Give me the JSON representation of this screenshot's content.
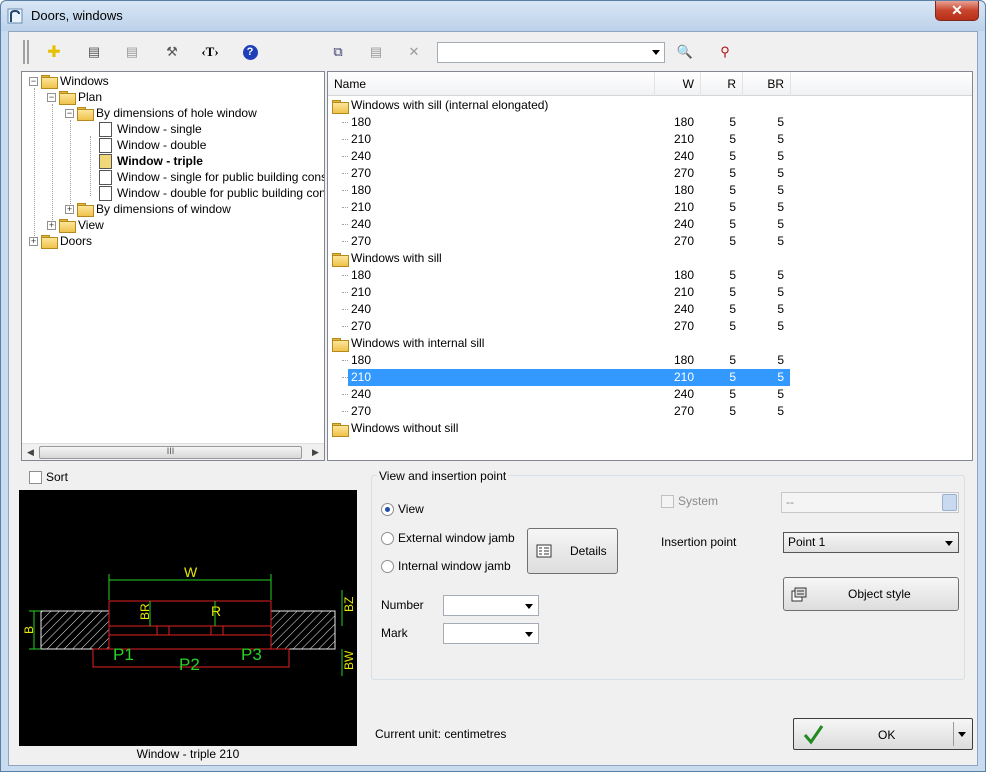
{
  "window": {
    "title": "Doors, windows",
    "close_label": "✕"
  },
  "toolbar": {
    "buttons": [
      {
        "name": "add-icon",
        "glyph": "✚",
        "color": "#e6c000"
      },
      {
        "name": "edit-icon",
        "glyph": "▤",
        "color": "#555555"
      },
      {
        "name": "list-icon",
        "glyph": "▤",
        "color": "#9a9a9a"
      },
      {
        "name": "tools-icon",
        "glyph": "⚒",
        "color": "#555555"
      },
      {
        "name": "text-icon",
        "glyph": "‹T›",
        "color": "#000000"
      },
      {
        "name": "help-icon",
        "glyph": "?",
        "color": "#ffffff"
      },
      {
        "name": "copy-icon",
        "glyph": "⧉",
        "color": "#3a3a6a"
      },
      {
        "name": "properties-icon",
        "glyph": "▤",
        "color": "#9a9a9a"
      },
      {
        "name": "delete-icon",
        "glyph": "✕",
        "color": "#9a9a9a"
      },
      {
        "name": "search-icon",
        "glyph": "🔍",
        "color": "#1f4fa8"
      },
      {
        "name": "binoculars-icon",
        "glyph": "⚲",
        "color": "#aa1111"
      }
    ],
    "search_value": ""
  },
  "tree": {
    "nodes": [
      {
        "label": "Windows",
        "type": "folder",
        "expander": "−",
        "bold": false
      },
      {
        "label": "Plan",
        "type": "folder",
        "expander": "−",
        "bold": false
      },
      {
        "label": "By dimensions of hole window",
        "type": "folder",
        "expander": "−",
        "bold": false
      },
      {
        "label": "Window - single",
        "type": "doc",
        "expander": "",
        "bold": false
      },
      {
        "label": "Window - double",
        "type": "doc",
        "expander": "",
        "bold": false
      },
      {
        "label": "Window - triple",
        "type": "doc",
        "expander": "",
        "bold": true
      },
      {
        "label": "Window - single for public building constru",
        "type": "doc",
        "expander": "",
        "bold": false
      },
      {
        "label": "Window - double for public building constru",
        "type": "doc",
        "expander": "",
        "bold": false
      },
      {
        "label": "By dimensions of window",
        "type": "folder",
        "expander": "+",
        "bold": false
      },
      {
        "label": "View",
        "type": "folder",
        "expander": "+",
        "bold": false
      },
      {
        "label": "Doors",
        "type": "folder",
        "expander": "+",
        "bold": false
      }
    ],
    "scroll_label": "III"
  },
  "list": {
    "columns": [
      "Name",
      "W",
      "R",
      "BR"
    ],
    "groups": [
      {
        "label": "Windows with sill (internal elongated)",
        "rows": [
          [
            "180",
            "180",
            "5",
            "5"
          ],
          [
            "210",
            "210",
            "5",
            "5"
          ],
          [
            "240",
            "240",
            "5",
            "5"
          ],
          [
            "270",
            "270",
            "5",
            "5"
          ],
          [
            "180",
            "180",
            "5",
            "5"
          ],
          [
            "210",
            "210",
            "5",
            "5"
          ],
          [
            "240",
            "240",
            "5",
            "5"
          ],
          [
            "270",
            "270",
            "5",
            "5"
          ]
        ]
      },
      {
        "label": "Windows with sill",
        "rows": [
          [
            "180",
            "180",
            "5",
            "5"
          ],
          [
            "210",
            "210",
            "5",
            "5"
          ],
          [
            "240",
            "240",
            "5",
            "5"
          ],
          [
            "270",
            "270",
            "5",
            "5"
          ]
        ]
      },
      {
        "label": "Windows with internal sill",
        "rows": [
          [
            "180",
            "180",
            "5",
            "5"
          ],
          [
            "210",
            "210",
            "5",
            "5"
          ],
          [
            "240",
            "240",
            "5",
            "5"
          ],
          [
            "270",
            "270",
            "5",
            "5"
          ]
        ]
      },
      {
        "label": "Windows without sill",
        "rows": []
      }
    ],
    "selected": {
      "group": 2,
      "row": 1
    }
  },
  "sort_label": "Sort",
  "preview": {
    "caption": "Window - triple 210",
    "labels": {
      "w": "W",
      "r": "R",
      "br": "BR",
      "b": "B",
      "bz": "BZ",
      "bw": "BW",
      "p1": "P1",
      "p2": "P2",
      "p3": "P3"
    }
  },
  "view_group": {
    "title": "View and insertion point",
    "view_label": "View",
    "external_label": "External window jamb",
    "internal_label": "Internal window jamb",
    "details_label": "Details",
    "number_label": "Number",
    "number_value": "",
    "mark_label": "Mark",
    "mark_value": "",
    "system_label": "System",
    "system_value": "--",
    "insertion_label": "Insertion point",
    "insertion_value": "Point 1",
    "object_style_label": "Object style"
  },
  "status": {
    "unit_text": "Current unit: centimetres"
  },
  "ok_label": "OK"
}
